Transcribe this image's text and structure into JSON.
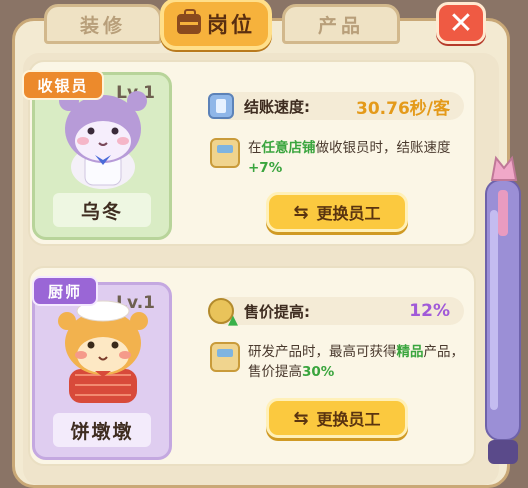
{
  "tabs": {
    "decor": "装修",
    "positions": "岗位",
    "products": "产品"
  },
  "close_label": "✕",
  "staff": [
    {
      "role": "收银员",
      "level": "Lv.1",
      "name": "乌冬",
      "stat_label": "结账速度:",
      "stat_value": "30.76秒/客",
      "desc_parts": [
        "在",
        "任意店铺",
        "做收银员时，结账速度",
        "+7%"
      ],
      "button": "更换员工"
    },
    {
      "role": "厨师",
      "level": "Lv.1",
      "name": "饼墩墩",
      "stat_label": "售价提高:",
      "stat_value": "12%",
      "desc_parts": [
        "研发产品时，最高可获得",
        "精品",
        "产品，售价提高",
        "30%"
      ],
      "button": "更换员工"
    }
  ],
  "colors": {
    "accent_gold": "#e49a1a",
    "accent_purple": "#a05ad8",
    "highlight_green": "#3aa53e",
    "cashier_ribbon": "#ec8a2c",
    "chef_ribbon": "#9a66d6"
  },
  "icons": {
    "positions_tab": "briefcase-icon",
    "close": "close-icon",
    "stat1": "phone-icon",
    "stat2": "coin-up-icon",
    "desc": "shop-icon",
    "button": "swap-icon"
  }
}
